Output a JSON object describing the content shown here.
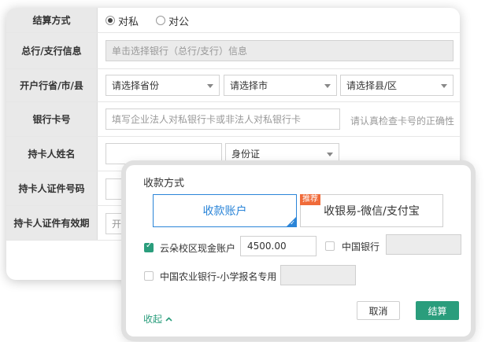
{
  "form": {
    "settlement_method": {
      "label": "结算方式",
      "options": [
        {
          "label": "对私",
          "checked": true
        },
        {
          "label": "对公",
          "checked": false
        }
      ]
    },
    "branch_info": {
      "label": "总行/支行信息",
      "placeholder": "单击选择银行（总行/支行）信息"
    },
    "account_region": {
      "label": "开户行省/市/县",
      "province_placeholder": "请选择省份",
      "city_placeholder": "请选择市",
      "county_placeholder": "请选择县/区"
    },
    "card_number": {
      "label": "银行卡号",
      "placeholder": "填写企业法人对私银行卡或非法人对私银行卡",
      "hint": "请认真检查卡号的正确性"
    },
    "holder_name": {
      "label": "持卡人姓名",
      "value": "",
      "id_type": "身份证"
    },
    "holder_id_number": {
      "label": "持卡人证件号码"
    },
    "holder_id_validity": {
      "label": "持卡人证件有效期",
      "placeholder": "开始"
    }
  },
  "payment_modal": {
    "title": "收款方式",
    "options": [
      {
        "label": "收款账户",
        "selected": true
      },
      {
        "label": "收银易-微信/支付宝",
        "selected": false,
        "badge": "推荐"
      }
    ],
    "accounts": [
      {
        "label": "云朵校区现金账户",
        "checked": true,
        "amount": "4500.00"
      },
      {
        "label": "中国银行",
        "checked": false,
        "amount": ""
      },
      {
        "label": "中国农业银行-小学报名专用",
        "checked": false,
        "amount": ""
      }
    ],
    "collapse_label": "收起",
    "cancel_label": "取消",
    "submit_label": "结算"
  },
  "colors": {
    "accent_blue": "#2b85d8",
    "accent_green": "#2a9d7c",
    "badge_orange": "#f06b3a"
  }
}
